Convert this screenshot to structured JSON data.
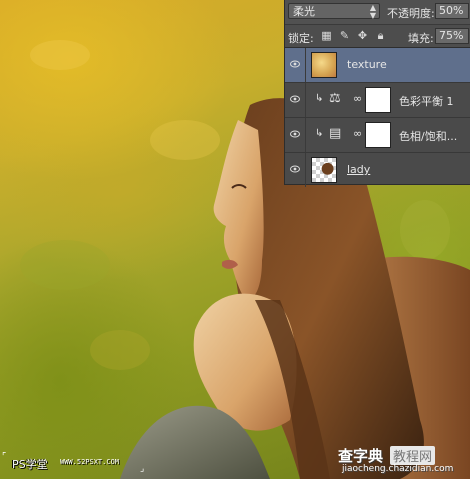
{
  "layers_panel": {
    "blend_mode": "柔光",
    "opacity_label": "不透明度:",
    "opacity_value": "50%",
    "lock_label": "锁定:",
    "fill_label": "填充:",
    "fill_value": "75%",
    "layers": [
      {
        "name": "texture",
        "selected": true
      },
      {
        "name": "色彩平衡 1",
        "selected": false
      },
      {
        "name": "色相/饱和...",
        "selected": false
      },
      {
        "name": "lady",
        "selected": false
      }
    ]
  },
  "watermarks": {
    "left_brand": "PS学堂",
    "left_url": "WWW.52PSXT.COM",
    "right_brand_a": "查字典",
    "right_brand_b": "教程网",
    "right_url": "jiaocheng.chazidian.com"
  },
  "colors": {
    "panel_bg": "#4a4a4a",
    "selected_row": "#5f6f8c",
    "texture_yellow": "#c8ae2c"
  }
}
